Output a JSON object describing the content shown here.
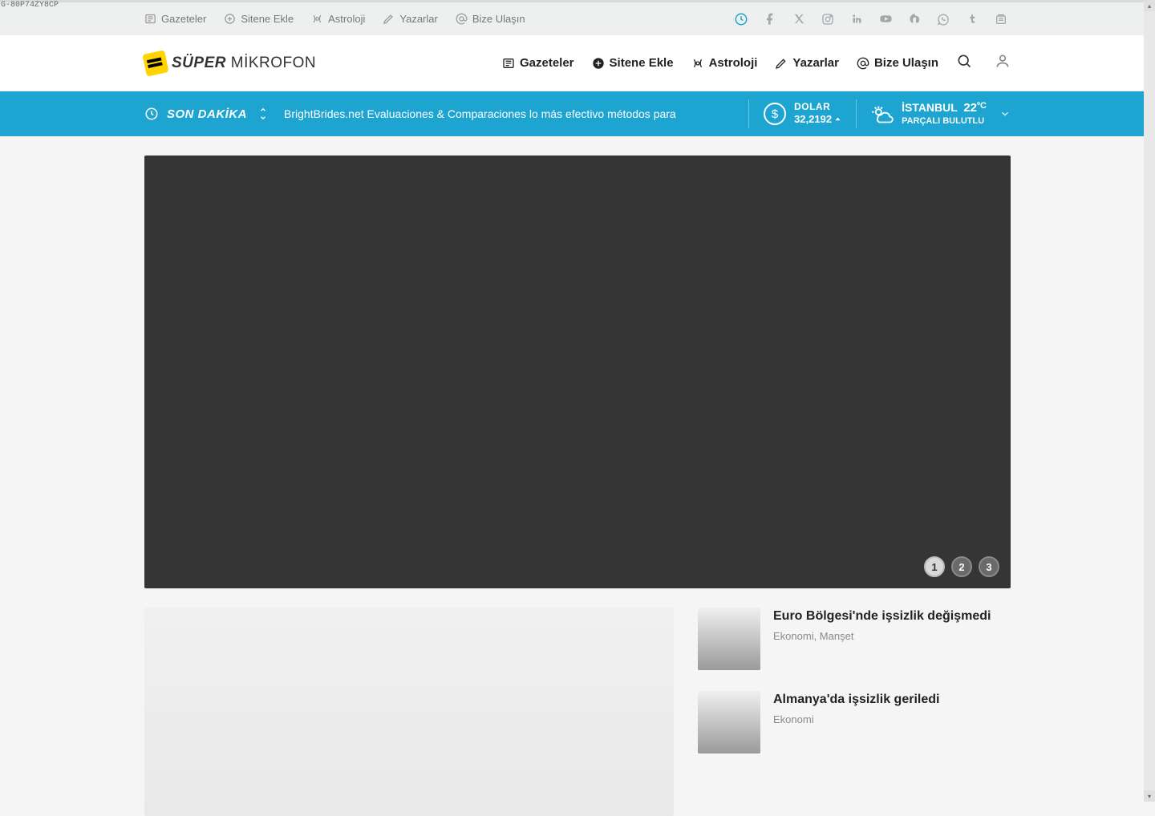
{
  "tracking_id": "G-80P74ZY8CP",
  "utilbar": {
    "items": [
      {
        "label": "Gazeteler",
        "icon": "newspaper"
      },
      {
        "label": "Sitene Ekle",
        "icon": "plus-circle"
      },
      {
        "label": "Astroloji",
        "icon": "zodiac"
      },
      {
        "label": "Yazarlar",
        "icon": "pen"
      },
      {
        "label": "Bize Ulaşın",
        "icon": "at"
      }
    ],
    "social": [
      "facebook",
      "x-twitter",
      "instagram",
      "linkedin",
      "youtube",
      "pinterest",
      "whatsapp",
      "tumblr",
      "google-news"
    ]
  },
  "logo": {
    "bold": "SÜPER",
    "light": "MİKROFON"
  },
  "mainnav": {
    "items": [
      {
        "label": "Gazeteler",
        "icon": "newspaper"
      },
      {
        "label": "Sitene Ekle",
        "icon": "plus-circle-filled"
      },
      {
        "label": "Astroloji",
        "icon": "zodiac"
      },
      {
        "label": "Yazarlar",
        "icon": "pen"
      },
      {
        "label": "Bize Ulaşın",
        "icon": "at"
      }
    ]
  },
  "ticker": {
    "label": "SON DAKİKA",
    "headline": "BrightBrides.net Evaluaciones & Comparaciones lo más efectivo métodos para"
  },
  "currency": {
    "name": "DOLAR",
    "value": "32,2192",
    "direction": "up"
  },
  "weather": {
    "city": "İSTANBUL",
    "temp": "22",
    "temp_unit": "ºC",
    "desc": "PARÇALI BULUTLU"
  },
  "hero": {
    "slides": [
      "1",
      "2",
      "3"
    ],
    "active": 0
  },
  "sidebar_news": [
    {
      "title": "Euro Bölgesi'nde işsizlik değişmedi",
      "cats": "Ekonomi, Manşet"
    },
    {
      "title": "Almanya'da işsizlik geriledi",
      "cats": "Ekonomi"
    }
  ]
}
